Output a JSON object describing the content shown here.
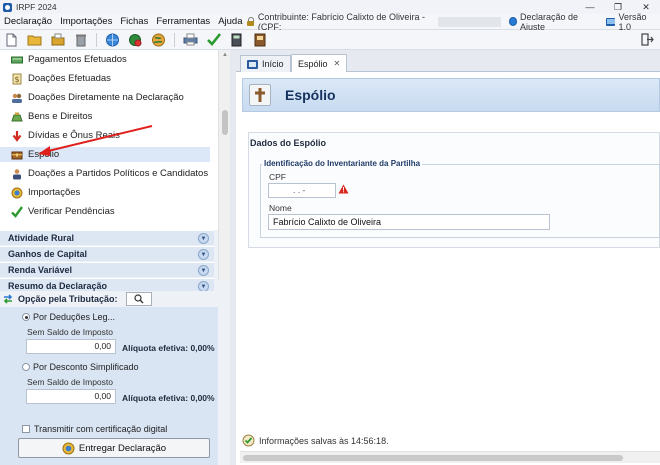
{
  "window": {
    "title": "IRPF 2024",
    "controls": [
      "—",
      "❐",
      "✕"
    ]
  },
  "menu": {
    "items": [
      "Declaração",
      "Importações",
      "Fichas",
      "Ferramentas",
      "Ajuda"
    ],
    "contribuinte": "Contribuinte: Fabrício Calixto de Oliveira - (CPF:",
    "declaracao_ajuste": "Declaração de Ajuste",
    "versao": "Versão 1.0"
  },
  "nav": {
    "items": [
      {
        "label": "Pagamentos Efetuados",
        "icon": "money-icon"
      },
      {
        "label": "Doações Efetuadas",
        "icon": "donation-icon"
      },
      {
        "label": "Doações Diretamente na Declaração",
        "icon": "people-icon"
      },
      {
        "label": "Bens e Direitos",
        "icon": "moneybag-icon"
      },
      {
        "label": "Dívidas e Ônus Reais",
        "icon": "debt-arrow-icon"
      },
      {
        "label": "Espólio",
        "icon": "chest-icon"
      },
      {
        "label": "Doações a Partidos Políticos e Candidatos",
        "icon": "candidate-icon"
      },
      {
        "label": "Importações",
        "icon": "import-icon"
      },
      {
        "label": "Verificar Pendências",
        "icon": "check-icon"
      }
    ],
    "categories": [
      "Atividade Rural",
      "Ganhos de Capital",
      "Renda Variável",
      "Resumo da Declaração"
    ]
  },
  "tributacao": {
    "label": "Opção pela Tributação:",
    "opt1_label": "Por Deduções Leg...",
    "opt1_sub": "Sem Saldo de Imposto",
    "opt1_value": "0,00",
    "opt1_aliq": "Alíquota efetiva: 0,00%",
    "opt2_label": "Por Desconto Simplificado",
    "opt2_sub": "Sem Saldo de Imposto",
    "opt2_value": "0,00",
    "opt2_aliq": "Alíquota efetiva: 0,00%",
    "transmitir_label": "Transmitir com certificação digital",
    "entregar_label": "Entregar Declaração"
  },
  "tabs": [
    {
      "label": "Início"
    },
    {
      "label": "Espólio",
      "close": "✕"
    }
  ],
  "page": {
    "title": "Espólio",
    "section_title": "Dados do Espólio",
    "group_title": "Identificação do Inventariante da Partilha",
    "cpf_label": "CPF",
    "cpf_value": ". . -",
    "nome_label": "Nome",
    "nome_value": "Fabrício Calixto de Oliveira",
    "status": "Informações salvas às 14:56:18."
  },
  "colors": {
    "accent": "#16325f",
    "selected": "#dce8f7",
    "arrow": "#e0201c",
    "panel": "#d9e5f3"
  }
}
